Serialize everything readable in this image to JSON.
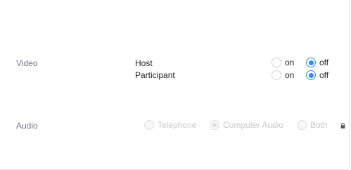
{
  "video": {
    "label": "Video",
    "rows": [
      {
        "label": "Host",
        "on_label": "on",
        "off_label": "off",
        "selected": "off"
      },
      {
        "label": "Participant",
        "on_label": "on",
        "off_label": "off",
        "selected": "off"
      }
    ]
  },
  "audio": {
    "label": "Audio",
    "options": [
      "Telephone",
      "Computer Audio",
      "Both"
    ],
    "selected": "Computer Audio",
    "locked": true,
    "lock_icon": "lock-icon"
  },
  "colors": {
    "accent": "#2d8cff",
    "label": "#747487",
    "text": "#222230",
    "disabled_text": "#c8c8d0"
  }
}
